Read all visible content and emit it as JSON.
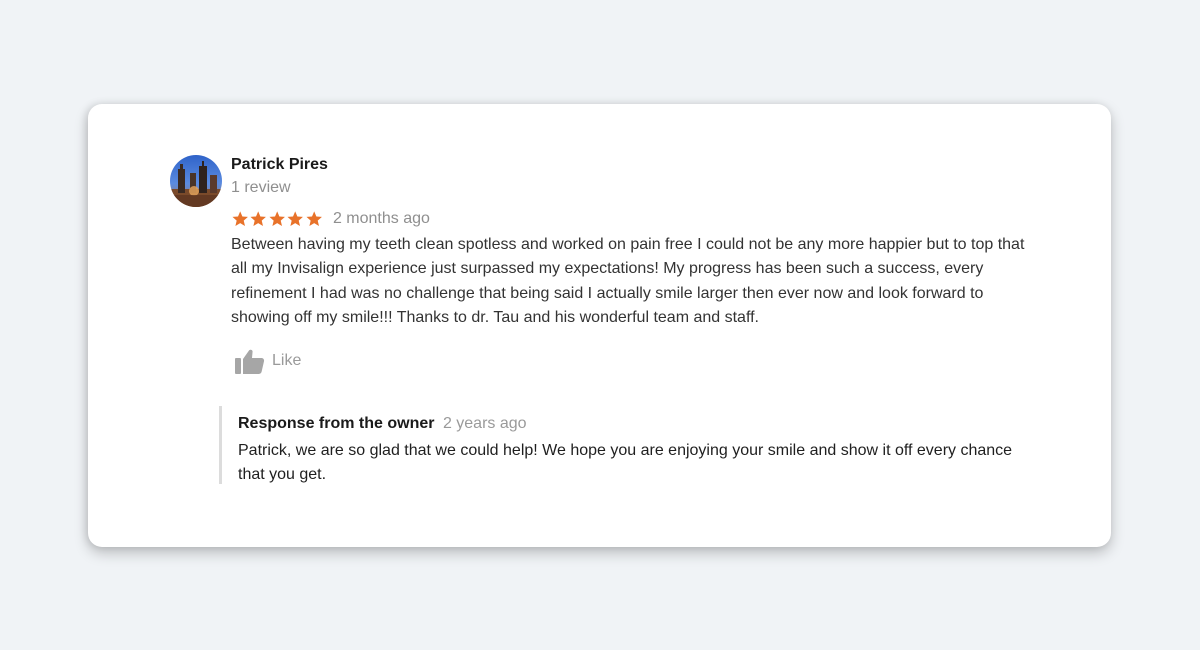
{
  "review": {
    "reviewer_name": "Patrick Pires",
    "review_count": "1 review",
    "rating": 5,
    "rating_max": 5,
    "time_ago": "2 months ago",
    "text": "Between having my teeth clean spotless and worked on pain free I could not be any more happier but to top that all my Invisalign experience just surpassed my expectations! My progress has been such a success, every refinement I had was no challenge that being said I actually smile larger then ever now and look forward to showing off my smile!!! Thanks to dr. Tau and his wonderful team and staff.",
    "like_label": "Like",
    "like_icon": "thumbs-up-icon",
    "star_color": "#e8722a"
  },
  "owner_response": {
    "title": "Response from the owner",
    "time_ago": "2 years ago",
    "text": "Patrick, we are so glad that we could help! We hope you are enjoying your smile and show it off every chance that you get."
  }
}
